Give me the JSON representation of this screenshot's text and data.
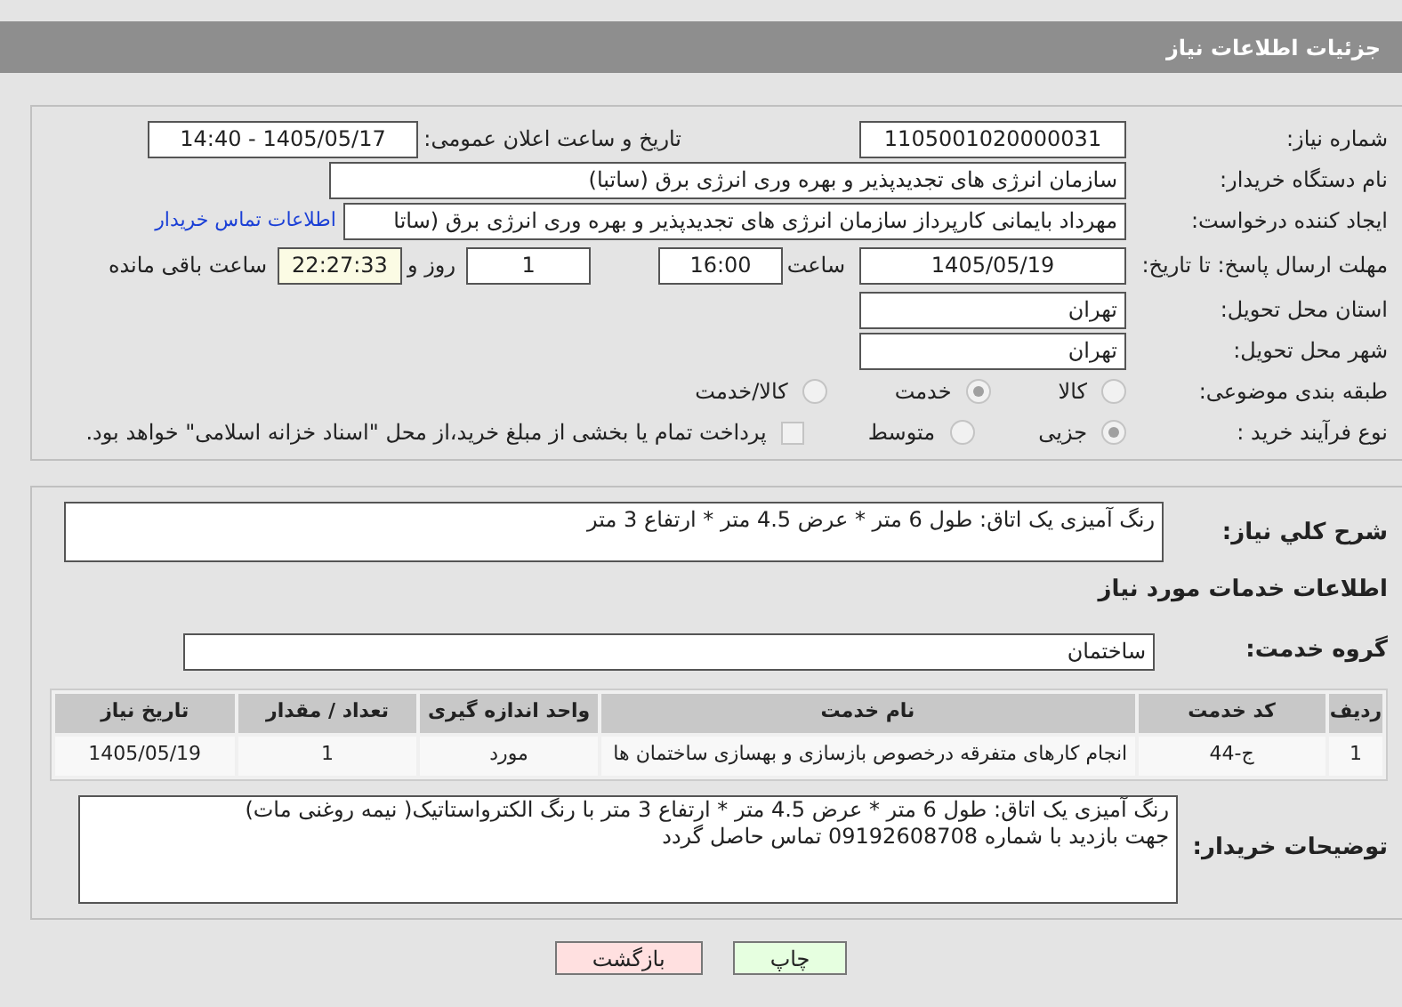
{
  "header": {
    "title": "جزئیات اطلاعات نیاز"
  },
  "need_info": {
    "need_number": {
      "label": "شماره نیاز:",
      "value": "1105001020000031"
    },
    "announce": {
      "label": "تاریخ و ساعت اعلان عمومی:",
      "value": "1405/05/17 - 14:40"
    },
    "buyer": {
      "label": "نام دستگاه خریدار:",
      "value": "سازمان انرژی های تجدیدپذیر و بهره وری انرژی برق (ساتبا)"
    },
    "creator": {
      "label": "ایجاد کننده درخواست:",
      "value": "مهرداد بایمانی کارپرداز سازمان انرژی های تجدیدپذیر و بهره وری انرژی برق (ساتا",
      "link": "اطلاعات تماس خریدار"
    },
    "deadline": {
      "label": "مهلت ارسال پاسخ: تا تاریخ:",
      "date": "1405/05/19",
      "time_label": "ساعت",
      "time": "16:00",
      "days": "1",
      "days_label": "روز و",
      "remaining": "22:27:33",
      "remaining_label": "ساعت باقی مانده"
    },
    "province": {
      "label": "استان محل تحویل:",
      "value": "تهران"
    },
    "city": {
      "label": "شهر محل تحویل:",
      "value": "تهران"
    },
    "category": {
      "label": "طبقه بندی موضوعی:",
      "options": [
        {
          "label": "کالا",
          "selected": false
        },
        {
          "label": "خدمت",
          "selected": true
        },
        {
          "label": "کالا/خدمت",
          "selected": false
        }
      ]
    },
    "process": {
      "label": "نوع فرآیند خرید :",
      "options": [
        {
          "label": "جزیی",
          "selected": true
        },
        {
          "label": "متوسط",
          "selected": false
        }
      ],
      "payment": {
        "label": "پرداخت تمام یا بخشی از مبلغ خرید،از محل \"اسناد خزانه اسلامی\" خواهد بود.",
        "checked": false
      }
    }
  },
  "services": {
    "description": {
      "label": "شرح کلي نياز:",
      "value": "رنگ آمیزی یک اتاق:  طول 6 متر * عرض 4.5 متر * ارتفاع 3 متر"
    },
    "heading": "اطلاعات خدمات مورد نیاز",
    "group": {
      "label": "گروه خدمت:",
      "value": "ساختمان"
    },
    "table": {
      "columns": [
        "ردیف",
        "کد خدمت",
        "نام خدمت",
        "واحد اندازه گیری",
        "تعداد / مقدار",
        "تاریخ نیاز"
      ],
      "rows": [
        [
          "1",
          "ج-44",
          "انجام کارهای متفرقه درخصوص بازسازی و بهسازی ساختمان ها",
          "مورد",
          "1",
          "1405/05/19"
        ]
      ]
    },
    "buyer_notes": {
      "label": "توضیحات خریدار:",
      "lines": [
        "رنگ آمیزی یک اتاق:  طول 6 متر * عرض 4.5 متر * ارتفاع 3 متر با رنگ الکترواستاتیک( نیمه روغنی مات)",
        "جهت بازدید با شماره 09192608708 تماس حاصل گردد"
      ]
    }
  },
  "buttons": [
    {
      "label": "چاپ",
      "kind": "print"
    },
    {
      "label": "بازگشت",
      "kind": "back"
    }
  ]
}
